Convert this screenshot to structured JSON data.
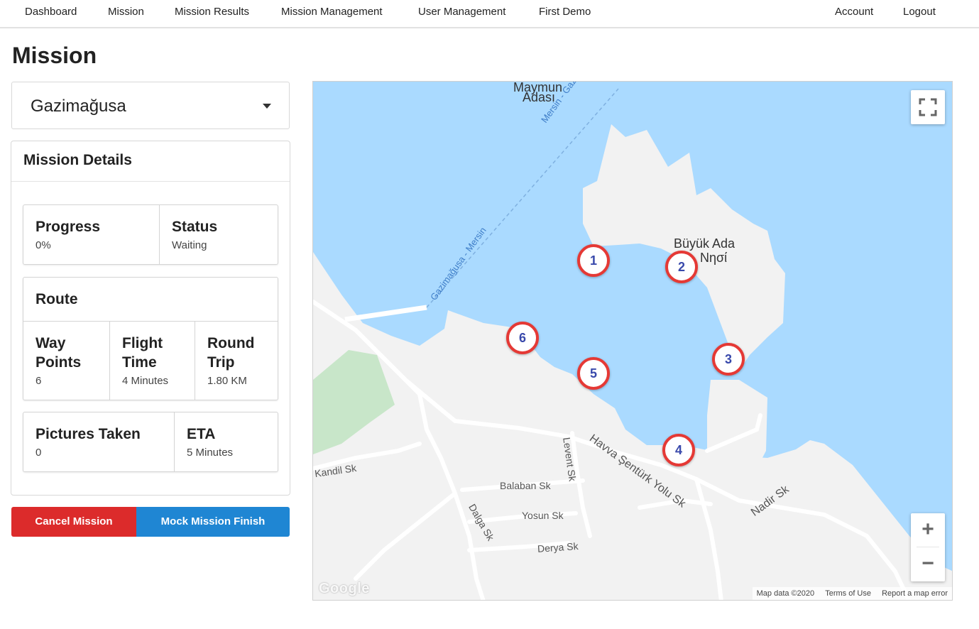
{
  "nav": {
    "items": [
      "Dashboard",
      "Mission",
      "Mission Results",
      "Mission Management",
      "User Management",
      "First Demo"
    ],
    "right": [
      "Account",
      "Logout"
    ]
  },
  "page": {
    "title": "Mission"
  },
  "location_select": {
    "value": "Gazimağusa"
  },
  "details": {
    "title": "Mission Details",
    "progress": {
      "label": "Progress",
      "value": "0%"
    },
    "status": {
      "label": "Status",
      "value": "Waiting"
    },
    "route": {
      "title": "Route",
      "way_points": {
        "label_line1": "Way",
        "label_line2": "Points",
        "value": "6"
      },
      "flight_time": {
        "label_line1": "Flight",
        "label_line2": "Time",
        "value": "4 Minutes"
      },
      "round_trip": {
        "label_line1": "Round",
        "label_line2": "Trip",
        "value": "1.80 KM"
      }
    },
    "pictures": {
      "label": "Pictures Taken",
      "value": "0"
    },
    "eta": {
      "label": "ETA",
      "value": "5 Minutes"
    }
  },
  "buttons": {
    "cancel": "Cancel Mission",
    "mock_finish": "Mock Mission Finish"
  },
  "map": {
    "island_name_1": "Büyük Ada",
    "island_name_2": "Νησί",
    "top_label_1": "Maymun",
    "top_label_2": "Adası",
    "route_label_1": "Mersin - Gazimağusa",
    "route_label_2": "Gazimağusa - Mersin",
    "streets": [
      "Kandil Sk",
      "Balaban Sk",
      "Levent Sk",
      "Havva Şentürk Yolu Sk",
      "Yosun Sk",
      "Dalga Sk",
      "Derya Sk",
      "Nadir Sk"
    ],
    "markers": [
      "1",
      "2",
      "3",
      "4",
      "5",
      "6"
    ],
    "zoom_in": "+",
    "zoom_out": "−",
    "google": "Google",
    "attribution": {
      "data": "Map data ©2020",
      "terms": "Terms of Use",
      "report": "Report a map error"
    },
    "colors": {
      "water": "#aadaff",
      "land": "#f2f2f2",
      "park": "#c8e6c9",
      "marker_ring": "#e53935",
      "marker_text": "#3949ab"
    }
  },
  "colors": {
    "cancel": "#dc2b2b",
    "mock": "#1f86d3"
  }
}
